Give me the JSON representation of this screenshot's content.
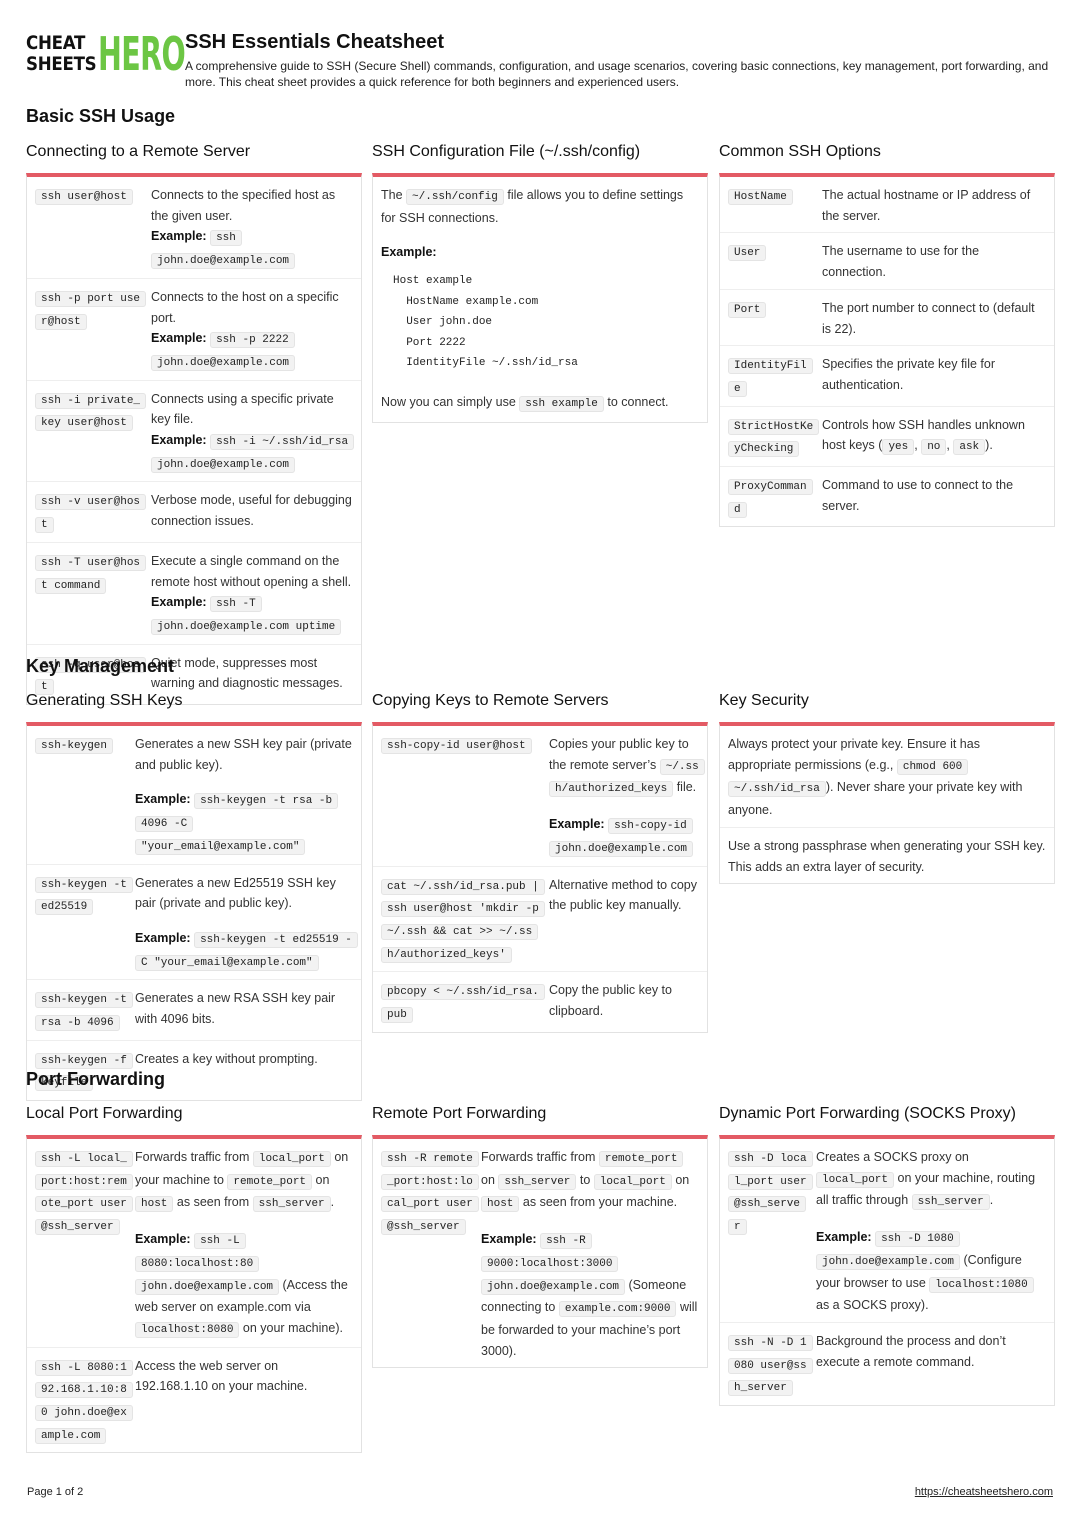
{
  "header": {
    "logo_line1": "CHEAT",
    "logo_line2": "SHEETS",
    "logo_hero": "HERO",
    "title": "SSH Essentials Cheatsheet",
    "description": "A comprehensive guide to SSH (Secure Shell) commands, configuration, and usage scenarios, covering basic connections, key management, port forwarding, and more. This cheat sheet provides a quick reference for both beginners and experienced users."
  },
  "colors": {
    "accent": "#e35a64",
    "logo_green": "#6cc644"
  },
  "example_label": "Example:",
  "sections": {
    "basic": {
      "title": "Basic SSH Usage",
      "connecting": {
        "title": "Connecting to a Remote Server",
        "rows": [
          {
            "cmd": "ssh user@host",
            "desc": "Connects to the specified host as the given user.",
            "example": "ssh john.doe@example.com"
          },
          {
            "cmd": "ssh -p port user@host",
            "desc": "Connects to the host on a specific port.",
            "example": "ssh -p 2222 john.doe@example.com"
          },
          {
            "cmd": "ssh -i private_key user@host",
            "desc": "Connects using a specific private key file.",
            "example": "ssh -i ~/.ssh/id_rsa john.doe@example.com"
          },
          {
            "cmd": "ssh -v user@host",
            "desc": "Verbose mode, useful for debugging connection issues."
          },
          {
            "cmd": "ssh -T user@host command",
            "desc": "Execute a single command on the remote host without opening a shell.",
            "example": "ssh -T john.doe@example.com uptime"
          },
          {
            "cmd": "ssh -q user@host",
            "desc": "Quiet mode, suppresses most warning and diagnostic messages."
          }
        ]
      },
      "config": {
        "title": "SSH Configuration File (~/.ssh/config)",
        "intro_pre": "The",
        "intro_code": "~/.ssh/config",
        "intro_post": "file allows you to define settings for SSH connections.",
        "example_label": "Example:",
        "config_lines": [
          "Host example",
          "  HostName example.com",
          "  User john.doe",
          "  Port 2222",
          "  IdentityFile ~/.ssh/id_rsa"
        ],
        "outro_pre": "Now you can simply use",
        "outro_code": "ssh example",
        "outro_post": "to connect."
      },
      "options": {
        "title": "Common SSH Options",
        "rows": [
          {
            "cmd": "HostName",
            "desc": "The actual hostname or IP address of the server."
          },
          {
            "cmd": "User",
            "desc": "The username to use for the connection."
          },
          {
            "cmd": "Port",
            "desc": "The port number to connect to (default is 22)."
          },
          {
            "cmd": "IdentityFile",
            "desc": "Specifies the private key file for authentication."
          },
          {
            "cmd": "StrictHostKeyChecking",
            "desc_pre": "Controls how SSH handles unknown host keys (",
            "codes": [
              "yes",
              "no",
              "ask"
            ],
            "desc_post": ")."
          },
          {
            "cmd": "ProxyCommand",
            "desc": "Command to use to connect to the server."
          }
        ]
      }
    },
    "keys": {
      "title": "Key Management",
      "generating": {
        "title": "Generating SSH Keys",
        "rows": [
          {
            "cmd": "ssh-keygen",
            "desc": "Generates a new SSH key pair (private and public key).",
            "example": "ssh-keygen -t rsa -b 4096 -C \"your_email@example.com\""
          },
          {
            "cmd": "ssh-keygen -t ed25519",
            "desc": "Generates a new Ed25519 SSH key pair (private and public key).",
            "example": "ssh-keygen -t ed25519 -C \"your_email@example.com\""
          },
          {
            "cmd": "ssh-keygen -t rsa -b 4096",
            "desc": "Generates a new RSA SSH key pair with 4096 bits."
          },
          {
            "cmd": "ssh-keygen -f keyfile",
            "desc": "Creates a key without prompting."
          }
        ]
      },
      "copying": {
        "title": "Copying Keys to Remote Servers",
        "rows": [
          {
            "cmd": "ssh-copy-id user@host",
            "desc_pre": "Copies your public key to the remote server’s",
            "code": "~/.ssh/authorized_keys",
            "desc_post": "file.",
            "example": "ssh-copy-id john.doe@example.com"
          },
          {
            "cmd": "cat ~/.ssh/id_rsa.pub | ssh user@host 'mkdir -p ~/.ssh && cat >> ~/.ssh/authorized_keys'",
            "desc": "Alternative method to copy the public key manually."
          },
          {
            "cmd": "pbcopy < ~/.ssh/id_rsa.pub",
            "desc": "Copy the public key to clipboard."
          }
        ]
      },
      "security": {
        "title": "Key Security",
        "items": [
          {
            "pre": "Always protect your private key. Ensure it has appropriate permissions (e.g.,",
            "code": "chmod 600 ~/.ssh/id_rsa",
            "post": "). Never share your private key with anyone."
          },
          {
            "text": "Use a strong passphrase when generating your SSH key. This adds an extra layer of security."
          }
        ]
      }
    },
    "ports": {
      "title": "Port Forwarding",
      "local": {
        "title": "Local Port Forwarding",
        "rows": [
          {
            "cmd": "ssh -L local_port:host:remote_port user@ssh_server",
            "p1": "Forwards traffic from",
            "c1": "local_port",
            "p2": "on your machine to",
            "c2": "remote_port",
            "p3": "on",
            "c3": "host",
            "p4": "as seen from",
            "c4": "ssh_server",
            "p5": ".",
            "example": "ssh -L 8080:localhost:80 john.doe@example.com",
            "ex_post1": "(Access the web server on example.com via",
            "ex_code": "localhost:8080",
            "ex_post2": "on your machine)."
          },
          {
            "cmd": "ssh -L 8080:192.168.1.10:80 john.doe@example.com",
            "desc": "Access the web server on 192.168.1.10 on your machine."
          }
        ]
      },
      "remote": {
        "title": "Remote Port Forwarding",
        "rows": [
          {
            "cmd": "ssh -R remote_port:host:local_port user@ssh_server",
            "p1": "Forwards traffic from",
            "c1": "remote_port",
            "p2": "on",
            "c2": "ssh_server",
            "p3": "to",
            "c3": "local_port",
            "p4": "on",
            "c4": "host",
            "p5": "as seen from your machine.",
            "example": "ssh -R 9000:localhost:3000 john.doe@example.com",
            "ex_post1": "(Someone connecting to",
            "ex_code": "example.com:9000",
            "ex_post2": "will be forwarded to your machine’s port 3000)."
          }
        ]
      },
      "dynamic": {
        "title": "Dynamic Port Forwarding (SOCKS Proxy)",
        "rows": [
          {
            "cmd": "ssh -D local_port user@ssh_server",
            "p1": "Creates a SOCKS proxy on",
            "c1": "local_port",
            "p2": "on your machine, routing all traffic through",
            "c2": "ssh_server",
            "p3": ".",
            "example": "ssh -D 1080 john.doe@example.com",
            "ex_post1": "(Configure your browser to use",
            "ex_code": "localhost:1080",
            "ex_post2": "as a SOCKS proxy)."
          },
          {
            "cmd": "ssh -N -D 1080 user@ssh_server",
            "desc": "Background the process and don’t execute a remote command."
          }
        ]
      }
    }
  },
  "footer": {
    "page": "Page 1 of 2",
    "link": "https://cheatsheetshero.com"
  }
}
